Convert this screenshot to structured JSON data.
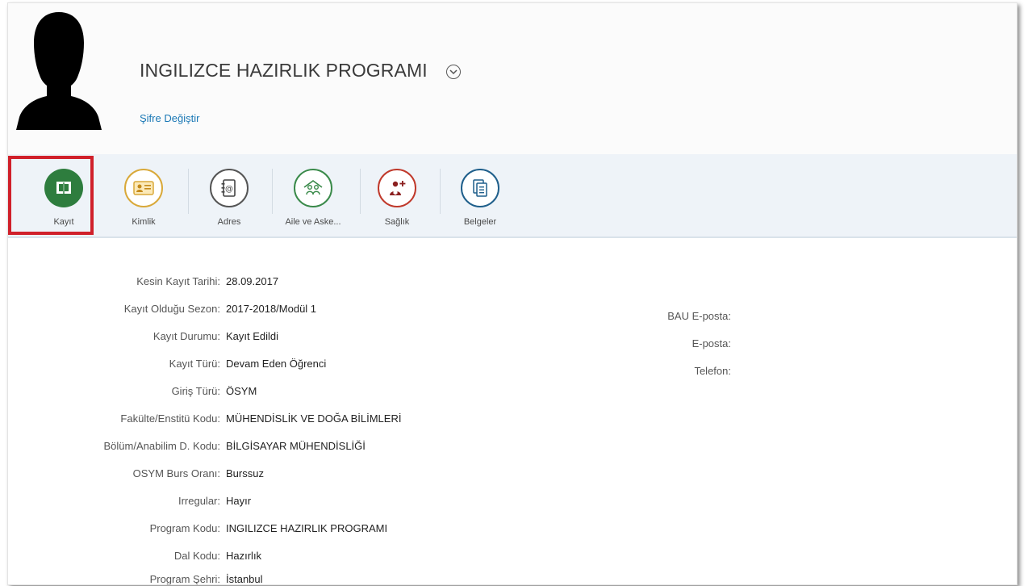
{
  "header": {
    "title": "INGILIZCE HAZIRLIK PROGRAMI",
    "password_link": "Şifre Değiştir"
  },
  "tabs": [
    {
      "label": "Kayıt",
      "icon": "book-icon",
      "color": "#2e7d3e",
      "filled": true
    },
    {
      "label": "Kimlik",
      "icon": "id-card-icon",
      "color": "#d9a93a",
      "filled": false
    },
    {
      "label": "Adres",
      "icon": "address-book-icon",
      "color": "#4a4a4a",
      "filled": false
    },
    {
      "label": "Aile ve Aske...",
      "icon": "family-icon",
      "color": "#3a8a4a",
      "filled": false
    },
    {
      "label": "Sağlık",
      "icon": "health-icon",
      "color": "#c0392b",
      "filled": false
    },
    {
      "label": "Belgeler",
      "icon": "documents-icon",
      "color": "#1f5f8b",
      "filled": false
    }
  ],
  "details": [
    {
      "key": "Kesin Kayıt Tarihi:",
      "value": "28.09.2017"
    },
    {
      "key": "Kayıt Olduğu Sezon:",
      "value": "2017-2018/Modül 1"
    },
    {
      "key": "Kayıt Durumu:",
      "value": "Kayıt Edildi"
    },
    {
      "key": "Kayıt Türü:",
      "value": "Devam Eden Öğrenci"
    },
    {
      "key": "Giriş Türü:",
      "value": "ÖSYM"
    },
    {
      "key": "Fakülte/Enstitü Kodu:",
      "value": "MÜHENDİSLİK VE DOĞA BİLİMLERİ"
    },
    {
      "key": "Bölüm/Anabilim D. Kodu:",
      "value": "BİLGİSAYAR MÜHENDİSLİĞİ"
    },
    {
      "key": "OSYM Burs Oranı:",
      "value": "Burssuz"
    },
    {
      "key": "Irregular:",
      "value": "Hayır"
    },
    {
      "key": "Program Kodu:",
      "value": "INGILIZCE HAZIRLIK PROGRAMI"
    },
    {
      "key": "Dal Kodu:",
      "value": "Hazırlık"
    },
    {
      "key": "Program Şehri:",
      "value": "İstanbul"
    }
  ],
  "contact": [
    {
      "key": "BAU E-posta:",
      "value": ""
    },
    {
      "key": "E-posta:",
      "value": ""
    },
    {
      "key": "Telefon:",
      "value": ""
    }
  ]
}
